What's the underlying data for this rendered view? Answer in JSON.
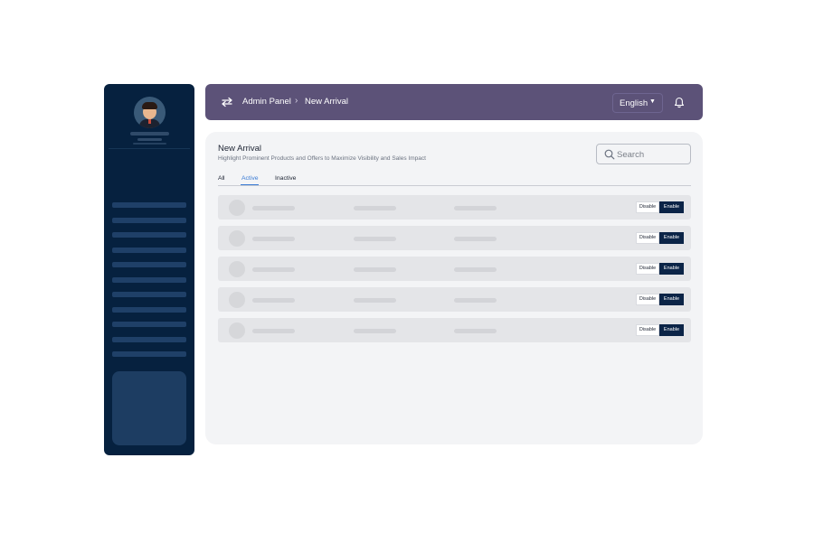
{
  "header": {
    "breadcrumb": [
      "Admin Panel",
      "New Arrival"
    ],
    "language": "English",
    "color": "#5c5278"
  },
  "page": {
    "title": "New Arrival",
    "subtitle": "Highlight Prominent Products and Offers to Maximize Visibility and Sales Impact"
  },
  "search": {
    "placeholder": "Search"
  },
  "tabs": [
    {
      "label": "All",
      "active": false
    },
    {
      "label": "Active",
      "active": true
    },
    {
      "label": "Inactive",
      "active": false
    }
  ],
  "rows": [
    {
      "disable_label": "Disable",
      "enable_label": "Enable"
    },
    {
      "disable_label": "Disable",
      "enable_label": "Enable"
    },
    {
      "disable_label": "Disable",
      "enable_label": "Enable"
    },
    {
      "disable_label": "Disable",
      "enable_label": "Enable"
    },
    {
      "disable_label": "Disable",
      "enable_label": "Enable"
    }
  ],
  "theme": {
    "sidebar": "#06213f",
    "accent": "#3a7bd5",
    "enable_button": "#0b2447"
  },
  "icons": {
    "toggle": "arrows-swap-icon",
    "bell": "bell-icon",
    "search": "search-icon",
    "avatar": "user-avatar"
  }
}
